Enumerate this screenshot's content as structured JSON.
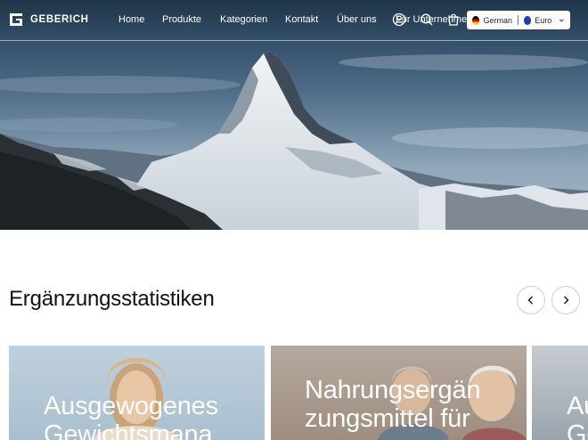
{
  "brand": {
    "name": "GEBERICH"
  },
  "nav": {
    "items": [
      {
        "label": "Home"
      },
      {
        "label": "Produkte"
      },
      {
        "label": "Kategorien"
      },
      {
        "label": "Kontakt"
      },
      {
        "label": "Über uns"
      },
      {
        "label": "Für Unternehmen"
      }
    ]
  },
  "header_icons": [
    "user-icon",
    "search-icon",
    "cart-icon"
  ],
  "locale": {
    "language": "German",
    "currency": "Euro"
  },
  "section": {
    "title": "Ergänzungsstatistiken"
  },
  "cards": [
    {
      "title": "Ausgewogenes Gewichtsmana"
    },
    {
      "title": "Nahrungsergän zungsmittel für"
    },
    {
      "title": "Au Ge"
    }
  ],
  "colors": {
    "text": "#111111",
    "header_text": "#ffffff",
    "border": "#d0d0d0"
  }
}
